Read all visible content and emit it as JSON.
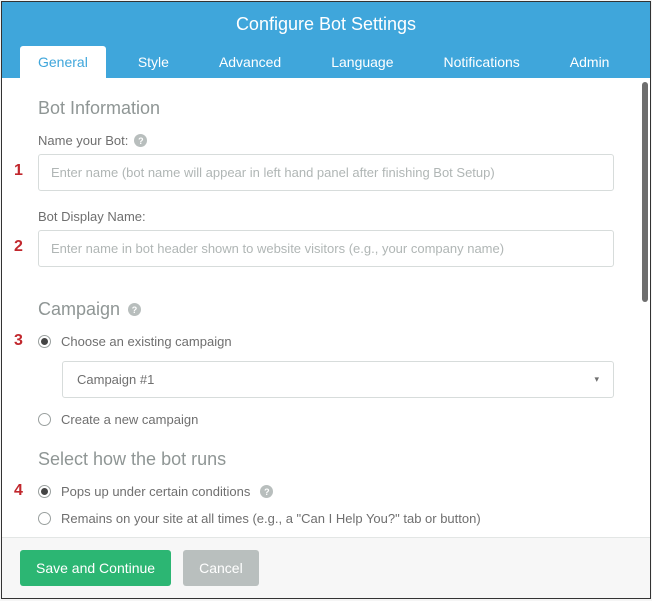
{
  "header": {
    "title": "Configure Bot Settings"
  },
  "tabs": [
    {
      "label": "General",
      "active": true
    },
    {
      "label": "Style"
    },
    {
      "label": "Advanced"
    },
    {
      "label": "Language"
    },
    {
      "label": "Notifications"
    },
    {
      "label": "Admin"
    }
  ],
  "steps": {
    "s1": "1",
    "s2": "2",
    "s3": "3",
    "s4": "4"
  },
  "bot_info": {
    "title": "Bot Information",
    "name_label": "Name your Bot:",
    "name_placeholder": "Enter name (bot name will appear in left hand panel after finishing Bot Setup)",
    "display_label": "Bot Display Name:",
    "display_placeholder": "Enter name in bot header shown to website visitors (e.g., your company name)"
  },
  "campaign": {
    "title": "Campaign",
    "existing_label": "Choose an existing campaign",
    "selected_value": "Campaign #1",
    "create_label": "Create a new campaign"
  },
  "run_mode": {
    "title": "Select how the bot runs",
    "popup_label": "Pops up under certain conditions",
    "remain_label": "Remains on your site at all times (e.g., a \"Can I Help You?\" tab or button)"
  },
  "footer": {
    "save_label": "Save and Continue",
    "cancel_label": "Cancel"
  },
  "icons": {
    "help": "?"
  }
}
